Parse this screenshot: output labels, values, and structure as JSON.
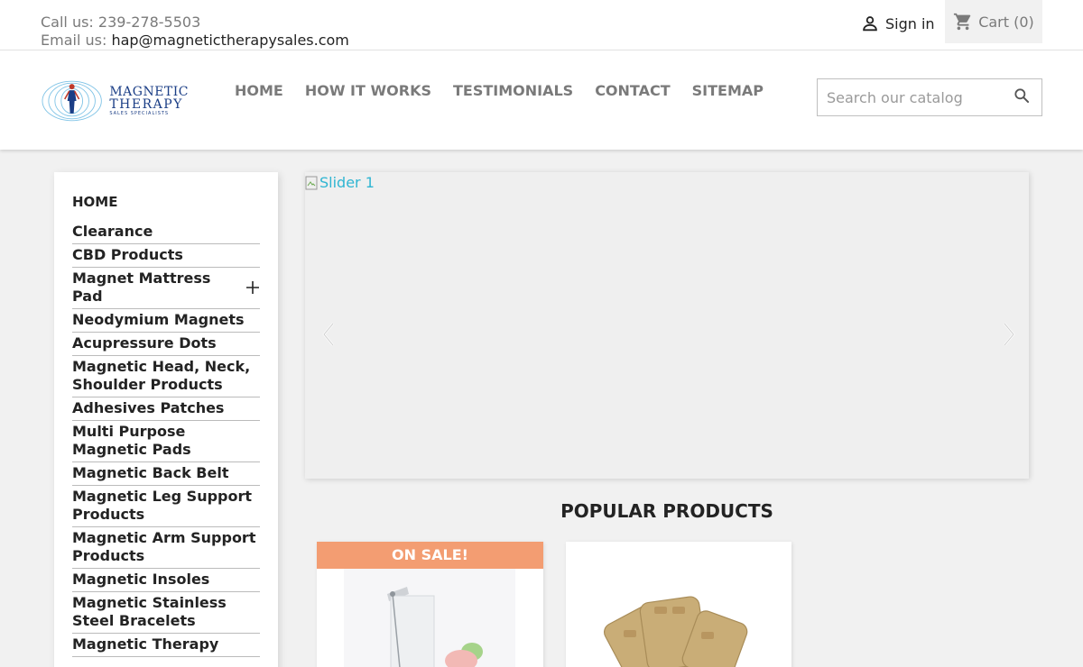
{
  "topbar": {
    "call_label": "Call us:",
    "phone": "239-278-5503",
    "email_label": "Email us:",
    "email": "hap@magnetictherapysales.com",
    "sign_in": "Sign in",
    "cart": "Cart (0)"
  },
  "logo": {
    "line1": "MAGNETIC",
    "line2": "THERAPY",
    "line3": "SALES SPECIALISTS"
  },
  "nav": [
    "HOME",
    "HOW IT WORKS",
    "TESTIMONIALS",
    "CONTACT",
    "SITEMAP"
  ],
  "search": {
    "placeholder": "Search our catalog"
  },
  "sidebar": {
    "title": "HOME",
    "items": [
      "Clearance",
      "CBD Products",
      "Magnet Mattress Pad",
      "Neodymium Magnets",
      "Acupressure Dots",
      "Magnetic Head, Neck, Shoulder Products",
      "Adhesives Patches",
      "Multi Purpose Magnetic Pads",
      "Magnetic Back Belt",
      "Magnetic Leg Support Products",
      "Magnetic Arm Support Products",
      "Magnetic Insoles",
      "Magnetic Stainless Steel Bracelets",
      "Magnetic Therapy"
    ]
  },
  "slider": {
    "alt": "Slider 1"
  },
  "popular": {
    "title": "POPULAR PRODUCTS",
    "badge": "ON SALE!"
  },
  "colors": {
    "accent": "#2fb5d2",
    "sale": "#f39d72",
    "logo": "#1b3e86"
  }
}
